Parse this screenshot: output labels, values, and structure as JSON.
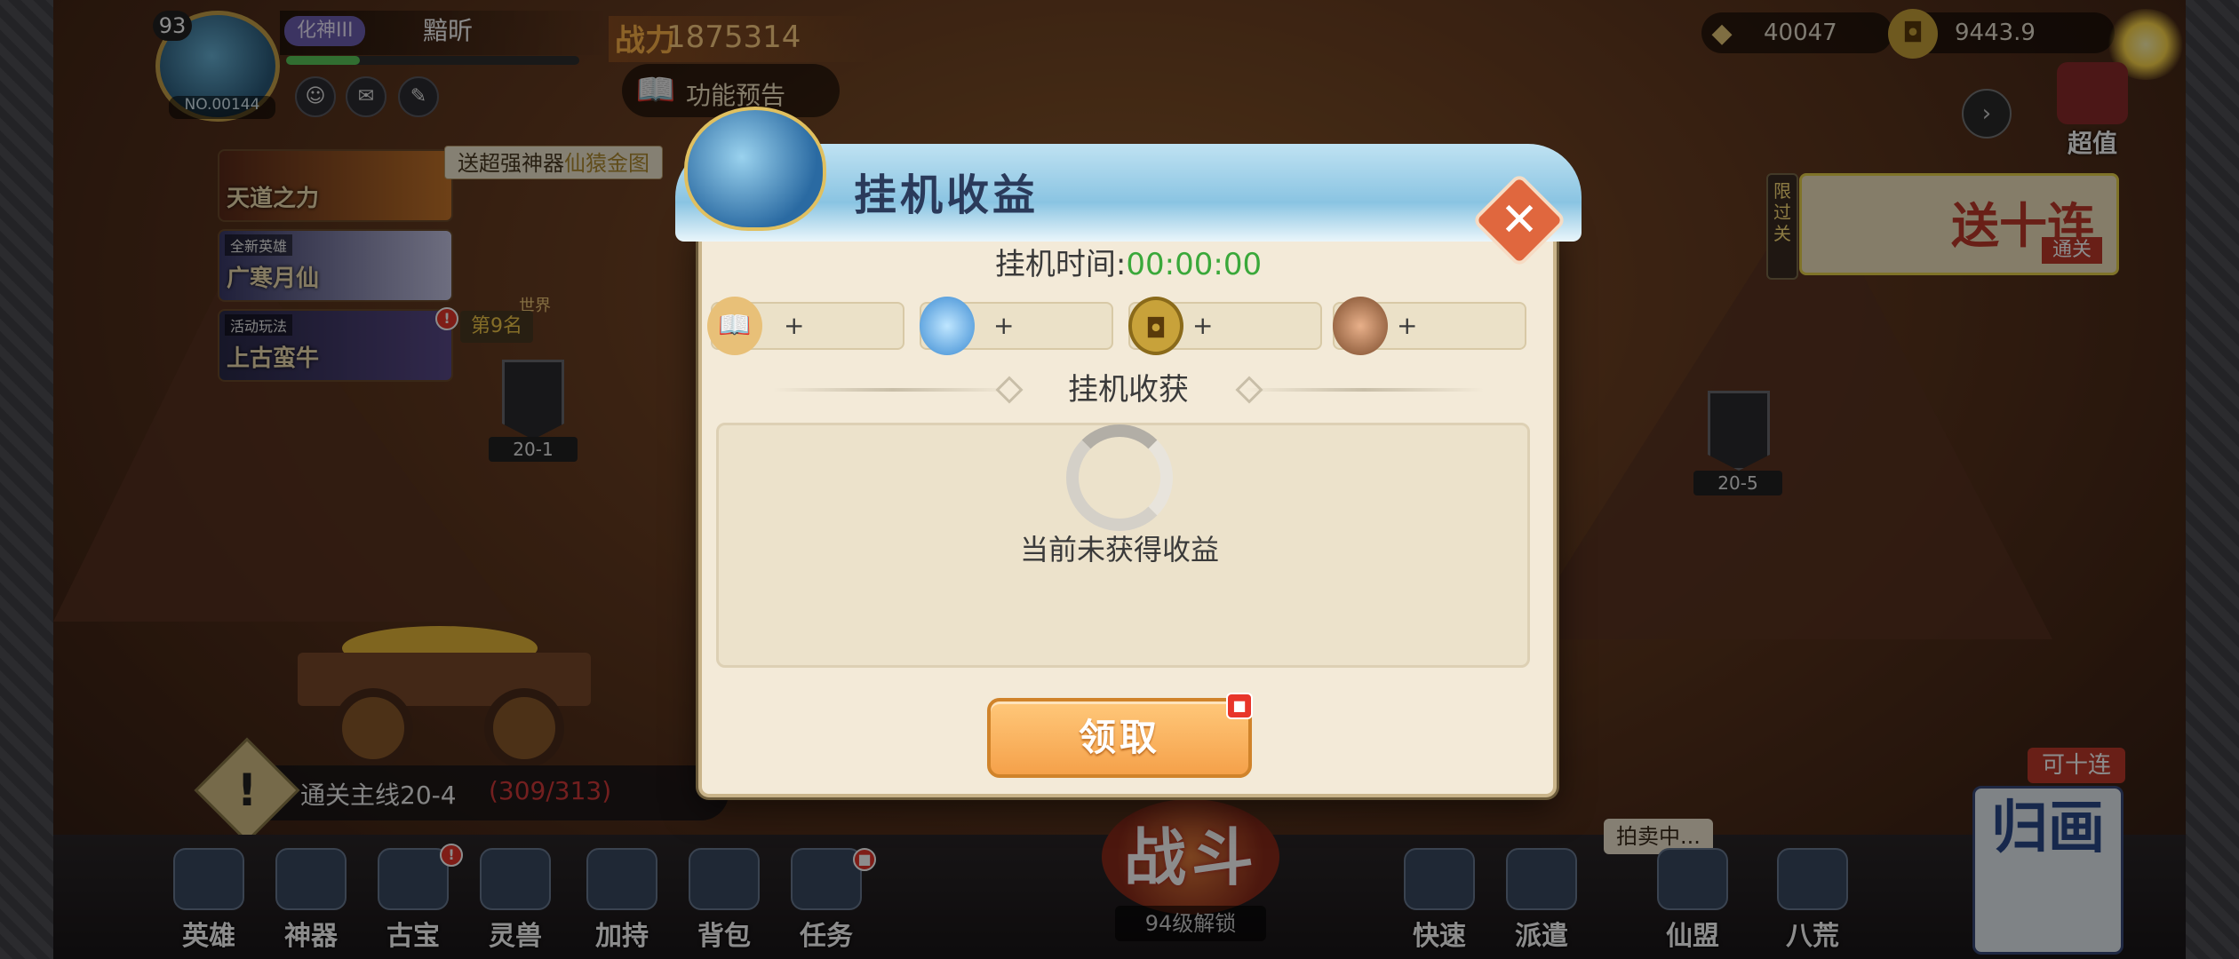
{
  "player": {
    "level": "93",
    "realm": "化神III",
    "name": "黯昕",
    "id": "NO.00144",
    "exp_fraction": 0.25
  },
  "combat_power": {
    "icon_text": "战力",
    "value": "1875314"
  },
  "feature_preview": {
    "label": "功能预告"
  },
  "side_cards": [
    {
      "title": "天道之力",
      "sub": ""
    },
    {
      "title": "广寒月仙",
      "sub": "全新英雄"
    },
    {
      "title": "上古蛮牛",
      "sub": "活动玩法"
    }
  ],
  "promo_text": {
    "prefix": "送超强神器",
    "highlight": "仙猿金图"
  },
  "rank": {
    "label": "第9名",
    "world": "世界"
  },
  "stages": {
    "left": "20-1",
    "right": "20-5"
  },
  "currencies": [
    {
      "icon": "ingot-icon",
      "value": "40047"
    },
    {
      "icon": "copper-coin-icon",
      "value": "9443.9"
    }
  ],
  "super_value": {
    "label": "超值"
  },
  "pass_tab": {
    "label": "限过关"
  },
  "ten_pull_banner": {
    "big": "送十连",
    "small": "通关"
  },
  "quest": {
    "text": "通关主线20-4",
    "progress": "(309/313)"
  },
  "bottom_nav": [
    {
      "key": "heroes",
      "label": "英雄"
    },
    {
      "key": "artifact",
      "label": "神器"
    },
    {
      "key": "treasure",
      "label": "古宝"
    },
    {
      "key": "spirit-beast",
      "label": "灵兽"
    },
    {
      "key": "blessing",
      "label": "加持"
    },
    {
      "key": "backpack",
      "label": "背包"
    },
    {
      "key": "tasks",
      "label": "任务"
    },
    {
      "key": "quick",
      "label": "快速"
    },
    {
      "key": "dispatch",
      "label": "派遣"
    },
    {
      "key": "alliance",
      "label": "仙盟"
    },
    {
      "key": "eight-wilds",
      "label": "八荒"
    }
  ],
  "battle": {
    "label": "战斗",
    "lock": "94级解锁"
  },
  "auction": {
    "label": "拍卖中..."
  },
  "ten_tag": {
    "label": "可十连"
  },
  "return_scroll": {
    "label": "归画"
  },
  "dialog": {
    "title": "挂机收益",
    "idle_time_label": "挂机时间:",
    "idle_time_value": "00:00:00",
    "rewards": [
      {
        "icon": "exp-book-icon",
        "plus": "+"
      },
      {
        "icon": "spirit-orb-icon",
        "plus": "+"
      },
      {
        "icon": "copper-coin-icon",
        "plus": "+"
      },
      {
        "icon": "ore-icon",
        "plus": "+"
      }
    ],
    "gains_heading": "挂机收获",
    "empty_text": "当前未获得收益",
    "claim_label": "领取"
  },
  "colors": {
    "accent_green": "#3aa83a",
    "claim_orange": "#f5a14a",
    "close_red": "#e0673e",
    "progress_red": "#d23a3a"
  }
}
